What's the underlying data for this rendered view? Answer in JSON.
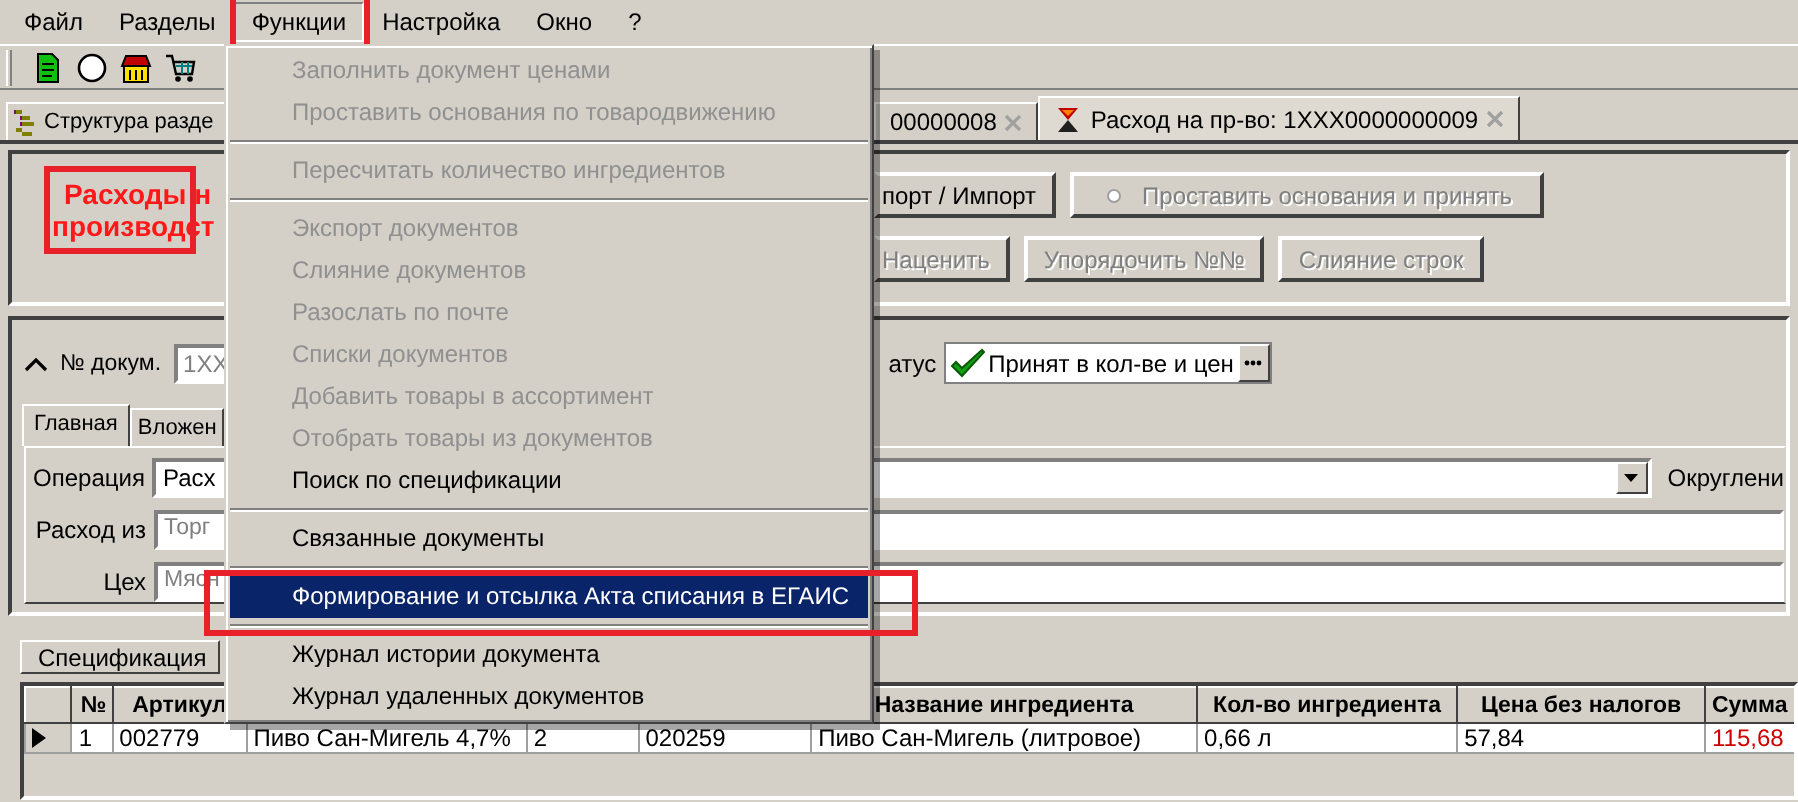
{
  "menubar": [
    {
      "label": "Файл",
      "selected": false,
      "annotated": false
    },
    {
      "label": "Разделы",
      "selected": false,
      "annotated": false
    },
    {
      "label": "Функции",
      "selected": true,
      "annotated": true
    },
    {
      "label": "Настройка",
      "selected": false,
      "annotated": false
    },
    {
      "label": "Окно",
      "selected": false,
      "annotated": false
    },
    {
      "label": "?",
      "selected": false,
      "annotated": false
    }
  ],
  "doc_tabs": [
    {
      "label": "Структура разде",
      "kind": "section",
      "selected": false,
      "closable": false
    },
    {
      "label": "00000008",
      "selected": false,
      "closable": true
    },
    {
      "label": "Расход на пр-во: 1XXX0000000009",
      "kind": "document",
      "selected": true,
      "closable": true
    }
  ],
  "header": {
    "title_lines": [
      "Расходы н",
      "производст"
    ],
    "annotated": true
  },
  "action_rows": [
    [
      {
        "label": "порт / Импорт",
        "kind": "plain",
        "disabled": false
      },
      {
        "label": "Проставить основания и принять",
        "kind": "marked",
        "disabled": true
      }
    ],
    [
      {
        "label": "Наценить",
        "kind": "plain",
        "disabled": true
      },
      {
        "label": "Упорядочить №№",
        "kind": "plain",
        "disabled": true
      },
      {
        "label": "Слияние строк",
        "kind": "plain",
        "disabled": true
      }
    ]
  ],
  "document": {
    "number_label": "№ докум.",
    "number_value": "1XX",
    "status_label": "атус",
    "status_value": "Принят в кол-ве и цен"
  },
  "form_tabs": [
    {
      "label": "Главная",
      "selected": true
    },
    {
      "label": "Вложен",
      "selected": false
    }
  ],
  "fields": [
    {
      "label": "Операция",
      "value": "Расх",
      "kind": "dropdown",
      "disabled": false
    },
    {
      "label": "Расход из",
      "value": "Торг",
      "kind": "text",
      "disabled": true
    },
    {
      "label": "Цех",
      "value": "Мясн",
      "kind": "text",
      "disabled": true
    }
  ],
  "rounding_label": "Округлени",
  "spec_tab": {
    "label": "Спецификация"
  },
  "table": {
    "columns": [
      {
        "label": "№"
      },
      {
        "label": "Артикул"
      },
      {},
      {},
      {},
      {
        "label": "Название ингредиента"
      },
      {
        "label": "Кол-во ингредиента"
      },
      {
        "label": "Цена без налогов"
      },
      {
        "label": "Сумма",
        "emphasis": true
      }
    ],
    "rows": [
      {
        "current": true,
        "cells": [
          "1",
          "002779",
          "Пиво Сан-Мигель  4,7%",
          "2",
          "020259",
          "Пиво Сан-Мигель (литровое)",
          "0,66 л",
          "57,84",
          "115,68"
        ]
      }
    ]
  },
  "menu": {
    "items": [
      {
        "kind": "item",
        "label": "Заполнить документ ценами",
        "disabled": true,
        "selected": false,
        "annotated": false
      },
      {
        "kind": "item",
        "label": "Проставить основания по товародвижению",
        "disabled": true,
        "selected": false,
        "annotated": false
      },
      {
        "kind": "separator"
      },
      {
        "kind": "item",
        "label": "Пересчитать количество ингредиентов",
        "disabled": true,
        "selected": false,
        "annotated": false
      },
      {
        "kind": "separator"
      },
      {
        "kind": "item",
        "label": "Экспорт документов",
        "disabled": true,
        "selected": false,
        "annotated": false
      },
      {
        "kind": "item",
        "label": "Слияние документов",
        "disabled": true,
        "selected": false,
        "annotated": false
      },
      {
        "kind": "item",
        "label": "Разослать по почте",
        "disabled": true,
        "selected": false,
        "annotated": false
      },
      {
        "kind": "item",
        "label": "Списки документов",
        "disabled": true,
        "selected": false,
        "annotated": false
      },
      {
        "kind": "item",
        "label": "Добавить товары в ассортимент",
        "disabled": true,
        "selected": false,
        "annotated": false
      },
      {
        "kind": "item",
        "label": "Отобрать товары из документов",
        "disabled": true,
        "selected": false,
        "annotated": false
      },
      {
        "kind": "item",
        "label": "Поиск по спецификации",
        "disabled": false,
        "selected": false,
        "annotated": false
      },
      {
        "kind": "separator"
      },
      {
        "kind": "item",
        "label": "Связанные документы",
        "disabled": false,
        "selected": false,
        "annotated": false
      },
      {
        "kind": "separator"
      },
      {
        "kind": "item",
        "label": "Формирование и отсылка Акта списания в ЕГАИС",
        "disabled": false,
        "selected": true,
        "annotated": true
      },
      {
        "kind": "separator"
      },
      {
        "kind": "item",
        "label": "Журнал истории документа",
        "disabled": false,
        "selected": false,
        "annotated": false
      },
      {
        "kind": "item",
        "label": "Журнал удаленных документов",
        "disabled": false,
        "selected": false,
        "annotated": false
      }
    ]
  }
}
